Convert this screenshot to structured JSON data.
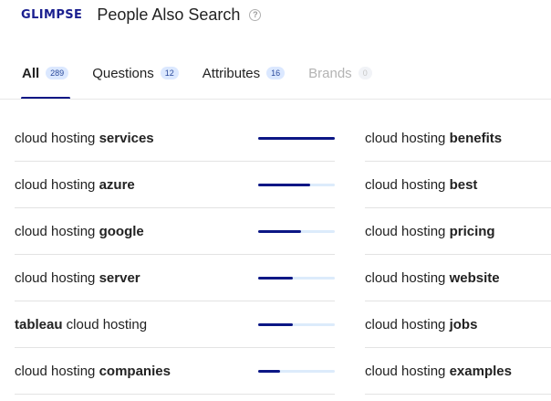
{
  "header": {
    "logo": "GLIMPSE",
    "title": "People Also Search",
    "help_icon": "question-circle-icon"
  },
  "tabs": [
    {
      "label": "All",
      "count": "289",
      "state": "active"
    },
    {
      "label": "Questions",
      "count": "12",
      "state": "normal"
    },
    {
      "label": "Attributes",
      "count": "16",
      "state": "normal"
    },
    {
      "label": "Brands",
      "count": "0",
      "state": "disabled"
    }
  ],
  "colors": {
    "accent": "#0c1785",
    "bar_track": "#dcebfb",
    "badge_bg": "#dbe8ff"
  },
  "left_results": [
    {
      "prefix": "cloud hosting ",
      "bold": "services",
      "suffix": "",
      "popularity": 1.0
    },
    {
      "prefix": "cloud hosting ",
      "bold": "azure",
      "suffix": "",
      "popularity": 0.68
    },
    {
      "prefix": "cloud hosting ",
      "bold": "google",
      "suffix": "",
      "popularity": 0.56
    },
    {
      "prefix": "cloud hosting ",
      "bold": "server",
      "suffix": "",
      "popularity": 0.45
    },
    {
      "prefix": "",
      "bold": "tableau",
      "suffix": " cloud hosting",
      "popularity": 0.45
    },
    {
      "prefix": "cloud hosting ",
      "bold": "companies",
      "suffix": "",
      "popularity": 0.29
    }
  ],
  "right_results": [
    {
      "prefix": "cloud hosting ",
      "bold": "benefits",
      "suffix": ""
    },
    {
      "prefix": "cloud hosting ",
      "bold": "best",
      "suffix": ""
    },
    {
      "prefix": "cloud hosting ",
      "bold": "pricing",
      "suffix": ""
    },
    {
      "prefix": "cloud hosting ",
      "bold": "website",
      "suffix": ""
    },
    {
      "prefix": "cloud hosting ",
      "bold": "jobs",
      "suffix": ""
    },
    {
      "prefix": "cloud hosting ",
      "bold": "examples",
      "suffix": ""
    }
  ]
}
